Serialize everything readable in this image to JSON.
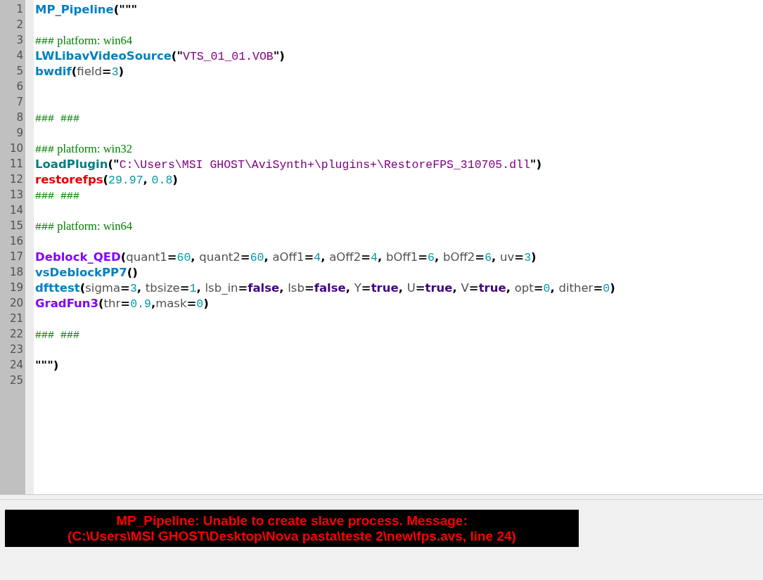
{
  "editor": {
    "lines": [
      {
        "number": "1",
        "tokens": [
          {
            "kind": "core",
            "text": "MP_Pipeline"
          },
          {
            "kind": "op",
            "text": "(\"\"\""
          }
        ]
      },
      {
        "number": "2"
      },
      {
        "number": "3",
        "tokens": [
          {
            "kind": "hash",
            "text": "###"
          },
          {
            "kind": "comment",
            "text": " platform: win64"
          }
        ]
      },
      {
        "number": "4",
        "tokens": [
          {
            "kind": "core",
            "text": "LWLibavVideoSource"
          },
          {
            "kind": "op",
            "text": "(\""
          },
          {
            "kind": "string",
            "text": "VTS_01_01.VOB"
          },
          {
            "kind": "op",
            "text": "\")"
          }
        ]
      },
      {
        "number": "5",
        "tokens": [
          {
            "kind": "core",
            "text": "bwdif"
          },
          {
            "kind": "op",
            "text": "("
          },
          {
            "kind": "text",
            "text": "field"
          },
          {
            "kind": "op",
            "text": "="
          },
          {
            "kind": "number",
            "text": "3"
          },
          {
            "kind": "op",
            "text": ")"
          }
        ]
      },
      {
        "number": "6"
      },
      {
        "number": "7"
      },
      {
        "number": "8",
        "tokens": [
          {
            "kind": "hash",
            "text": "### ###"
          }
        ]
      },
      {
        "number": "9"
      },
      {
        "number": "10",
        "tokens": [
          {
            "kind": "hash",
            "text": "###"
          },
          {
            "kind": "comment",
            "text": " platform: win32"
          }
        ]
      },
      {
        "number": "11",
        "tokens": [
          {
            "kind": "plugin",
            "text": "LoadPlugin"
          },
          {
            "kind": "op",
            "text": "(\""
          },
          {
            "kind": "string",
            "text": "C:\\Users\\MSI GHOST\\AviSynth+\\plugins+\\RestoreFPS_310705.dll"
          },
          {
            "kind": "op",
            "text": "\")"
          }
        ]
      },
      {
        "number": "12",
        "tokens": [
          {
            "kind": "external",
            "text": "restorefps"
          },
          {
            "kind": "op",
            "text": "("
          },
          {
            "kind": "number",
            "text": "29.97"
          },
          {
            "kind": "op",
            "text": ", "
          },
          {
            "kind": "number",
            "text": "0.8"
          },
          {
            "kind": "op",
            "text": ")"
          }
        ]
      },
      {
        "number": "13",
        "tokens": [
          {
            "kind": "hash",
            "text": "### ###"
          }
        ]
      },
      {
        "number": "14"
      },
      {
        "number": "15",
        "tokens": [
          {
            "kind": "hash",
            "text": "###"
          },
          {
            "kind": "comment",
            "text": " platform: win64"
          }
        ]
      },
      {
        "number": "16"
      },
      {
        "number": "17",
        "tokens": [
          {
            "kind": "filter",
            "text": "Deblock_QED"
          },
          {
            "kind": "op",
            "text": "("
          },
          {
            "kind": "text",
            "text": "quant1"
          },
          {
            "kind": "op",
            "text": "="
          },
          {
            "kind": "number",
            "text": "60"
          },
          {
            "kind": "op",
            "text": ", "
          },
          {
            "kind": "text",
            "text": "quant2"
          },
          {
            "kind": "op",
            "text": "="
          },
          {
            "kind": "number",
            "text": "60"
          },
          {
            "kind": "op",
            "text": ", "
          },
          {
            "kind": "text",
            "text": "aOff1"
          },
          {
            "kind": "op",
            "text": "="
          },
          {
            "kind": "number",
            "text": "4"
          },
          {
            "kind": "op",
            "text": ", "
          },
          {
            "kind": "text",
            "text": "aOff2"
          },
          {
            "kind": "op",
            "text": "="
          },
          {
            "kind": "number",
            "text": "4"
          },
          {
            "kind": "op",
            "text": ", "
          },
          {
            "kind": "text",
            "text": "bOff1"
          },
          {
            "kind": "op",
            "text": "="
          },
          {
            "kind": "number",
            "text": "6"
          },
          {
            "kind": "op",
            "text": ", "
          },
          {
            "kind": "text",
            "text": "bOff2"
          },
          {
            "kind": "op",
            "text": "="
          },
          {
            "kind": "number",
            "text": "6"
          },
          {
            "kind": "op",
            "text": ", "
          },
          {
            "kind": "text",
            "text": "uv"
          },
          {
            "kind": "op",
            "text": "="
          },
          {
            "kind": "number",
            "text": "3"
          },
          {
            "kind": "op",
            "text": ")"
          }
        ]
      },
      {
        "number": "18",
        "tokens": [
          {
            "kind": "core",
            "text": "vsDeblockPP7"
          },
          {
            "kind": "op",
            "text": "()"
          }
        ]
      },
      {
        "number": "19",
        "tokens": [
          {
            "kind": "core",
            "text": "dfttest"
          },
          {
            "kind": "op",
            "text": "("
          },
          {
            "kind": "text",
            "text": "sigma"
          },
          {
            "kind": "op",
            "text": "="
          },
          {
            "kind": "number",
            "text": "3"
          },
          {
            "kind": "op",
            "text": ", "
          },
          {
            "kind": "text",
            "text": "tbsize"
          },
          {
            "kind": "op",
            "text": "="
          },
          {
            "kind": "number",
            "text": "1"
          },
          {
            "kind": "op",
            "text": ", "
          },
          {
            "kind": "text",
            "text": "lsb_in"
          },
          {
            "kind": "op",
            "text": "="
          },
          {
            "kind": "keyword",
            "text": "false"
          },
          {
            "kind": "op",
            "text": ", "
          },
          {
            "kind": "text",
            "text": "lsb"
          },
          {
            "kind": "op",
            "text": "="
          },
          {
            "kind": "keyword",
            "text": "false"
          },
          {
            "kind": "op",
            "text": ", "
          },
          {
            "kind": "text",
            "text": "Y"
          },
          {
            "kind": "op",
            "text": "="
          },
          {
            "kind": "keyword",
            "text": "true"
          },
          {
            "kind": "op",
            "text": ", "
          },
          {
            "kind": "text",
            "text": "U"
          },
          {
            "kind": "op",
            "text": "="
          },
          {
            "kind": "keyword",
            "text": "true"
          },
          {
            "kind": "op",
            "text": ", "
          },
          {
            "kind": "text",
            "text": "V"
          },
          {
            "kind": "op",
            "text": "="
          },
          {
            "kind": "keyword",
            "text": "true"
          },
          {
            "kind": "op",
            "text": ", "
          },
          {
            "kind": "text",
            "text": "opt"
          },
          {
            "kind": "op",
            "text": "="
          },
          {
            "kind": "number",
            "text": "0"
          },
          {
            "kind": "op",
            "text": ", "
          },
          {
            "kind": "text",
            "text": "dither"
          },
          {
            "kind": "op",
            "text": "="
          },
          {
            "kind": "number",
            "text": "0"
          },
          {
            "kind": "op",
            "text": ")"
          }
        ]
      },
      {
        "number": "20",
        "tokens": [
          {
            "kind": "filter",
            "text": "GradFun3"
          },
          {
            "kind": "op",
            "text": "("
          },
          {
            "kind": "text",
            "text": "thr"
          },
          {
            "kind": "op",
            "text": "="
          },
          {
            "kind": "number",
            "text": "0.9"
          },
          {
            "kind": "op",
            "text": ","
          },
          {
            "kind": "text",
            "text": "mask"
          },
          {
            "kind": "op",
            "text": "="
          },
          {
            "kind": "number",
            "text": "0"
          },
          {
            "kind": "op",
            "text": ")"
          }
        ]
      },
      {
        "number": "21"
      },
      {
        "number": "22",
        "tokens": [
          {
            "kind": "hash",
            "text": "### ###"
          }
        ]
      },
      {
        "number": "23"
      },
      {
        "number": "24",
        "tokens": [
          {
            "kind": "op",
            "text": "\"\"\")"
          }
        ]
      },
      {
        "number": "25"
      }
    ]
  },
  "preview": {
    "error_lines": [
      "MP_Pipeline: Unable to create slave process. Message:",
      "(C:\\Users\\MSI GHOST\\Desktop\\Nova pasta\\teste 2\\new\\fps.avs, line 24)"
    ]
  }
}
